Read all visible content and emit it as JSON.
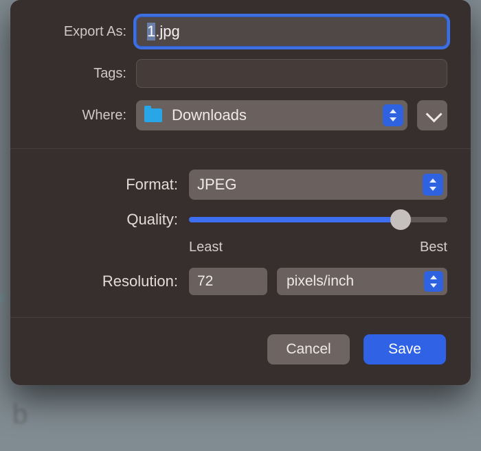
{
  "labels": {
    "export_as": "Export As:",
    "tags": "Tags:",
    "where": "Where:",
    "format": "Format:",
    "quality": "Quality:",
    "resolution": "Resolution:",
    "least": "Least",
    "best": "Best"
  },
  "fields": {
    "filename": "1.jpg",
    "where_folder": "Downloads",
    "format_value": "JPEG",
    "quality_percent": 82,
    "resolution_value": "72",
    "resolution_unit": "pixels/inch"
  },
  "buttons": {
    "cancel": "Cancel",
    "save": "Save"
  }
}
